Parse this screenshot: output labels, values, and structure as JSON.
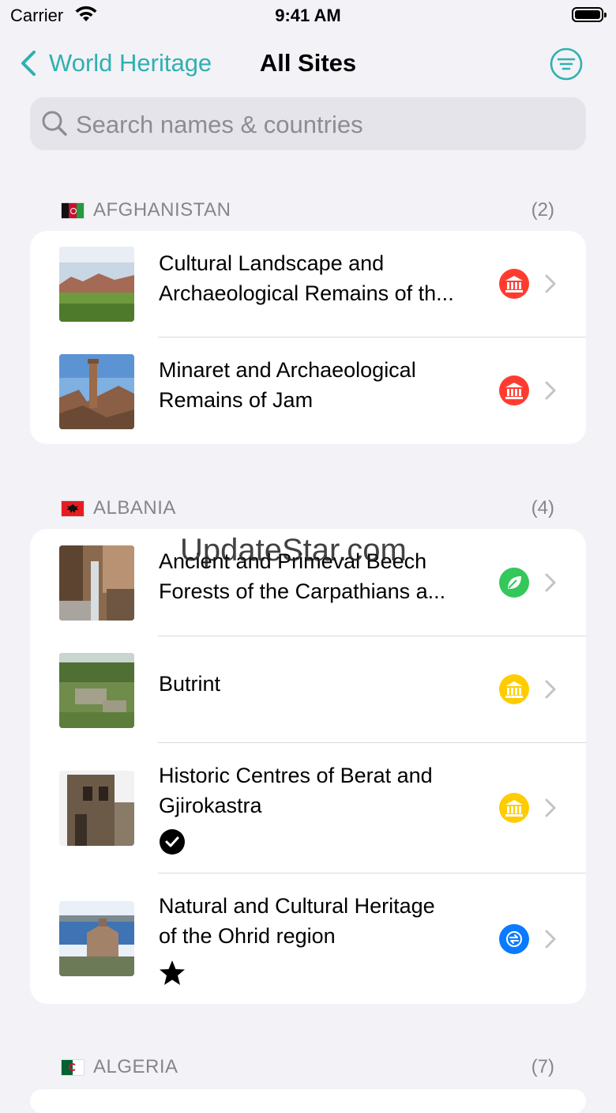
{
  "status_bar": {
    "carrier": "Carrier",
    "time": "9:41 AM"
  },
  "nav": {
    "back_label": "World Heritage",
    "title": "All Sites"
  },
  "search": {
    "placeholder": "Search names & countries",
    "value": ""
  },
  "colors": {
    "accent": "#30b0b0",
    "cultural_red": "#ff3b30",
    "cultural_yellow": "#ffcc00",
    "natural_green": "#34c759",
    "mixed_blue": "#0a7aff"
  },
  "sections": [
    {
      "country": "AFGHANISTAN",
      "count": "(2)",
      "sites": [
        {
          "line1": "Cultural Landscape and",
          "line2": "Archaeological Remains of th...",
          "category": "cultural",
          "category_color": "red",
          "status": ""
        },
        {
          "line1": "Minaret and Archaeological",
          "line2": "Remains of Jam",
          "category": "cultural",
          "category_color": "red",
          "status": ""
        }
      ]
    },
    {
      "country": "ALBANIA",
      "count": "(4)",
      "sites": [
        {
          "line1": "Ancient and Primeval Beech",
          "line2": "Forests of the Carpathians a...",
          "category": "natural",
          "category_color": "green",
          "status": ""
        },
        {
          "line1": "Butrint",
          "line2": "",
          "category": "cultural",
          "category_color": "yellow",
          "status": ""
        },
        {
          "line1": "Historic Centres of Berat and",
          "line2": "Gjirokastra",
          "category": "cultural",
          "category_color": "yellow",
          "status": "visited-check-icon"
        },
        {
          "line1": "Natural and Cultural Heritage",
          "line2": "of the Ohrid region",
          "category": "mixed",
          "category_color": "blue",
          "status": "starred-icon"
        }
      ]
    },
    {
      "country": "ALGERIA",
      "count": "(7)",
      "sites": []
    }
  ],
  "watermark": "UpdateStar.com"
}
